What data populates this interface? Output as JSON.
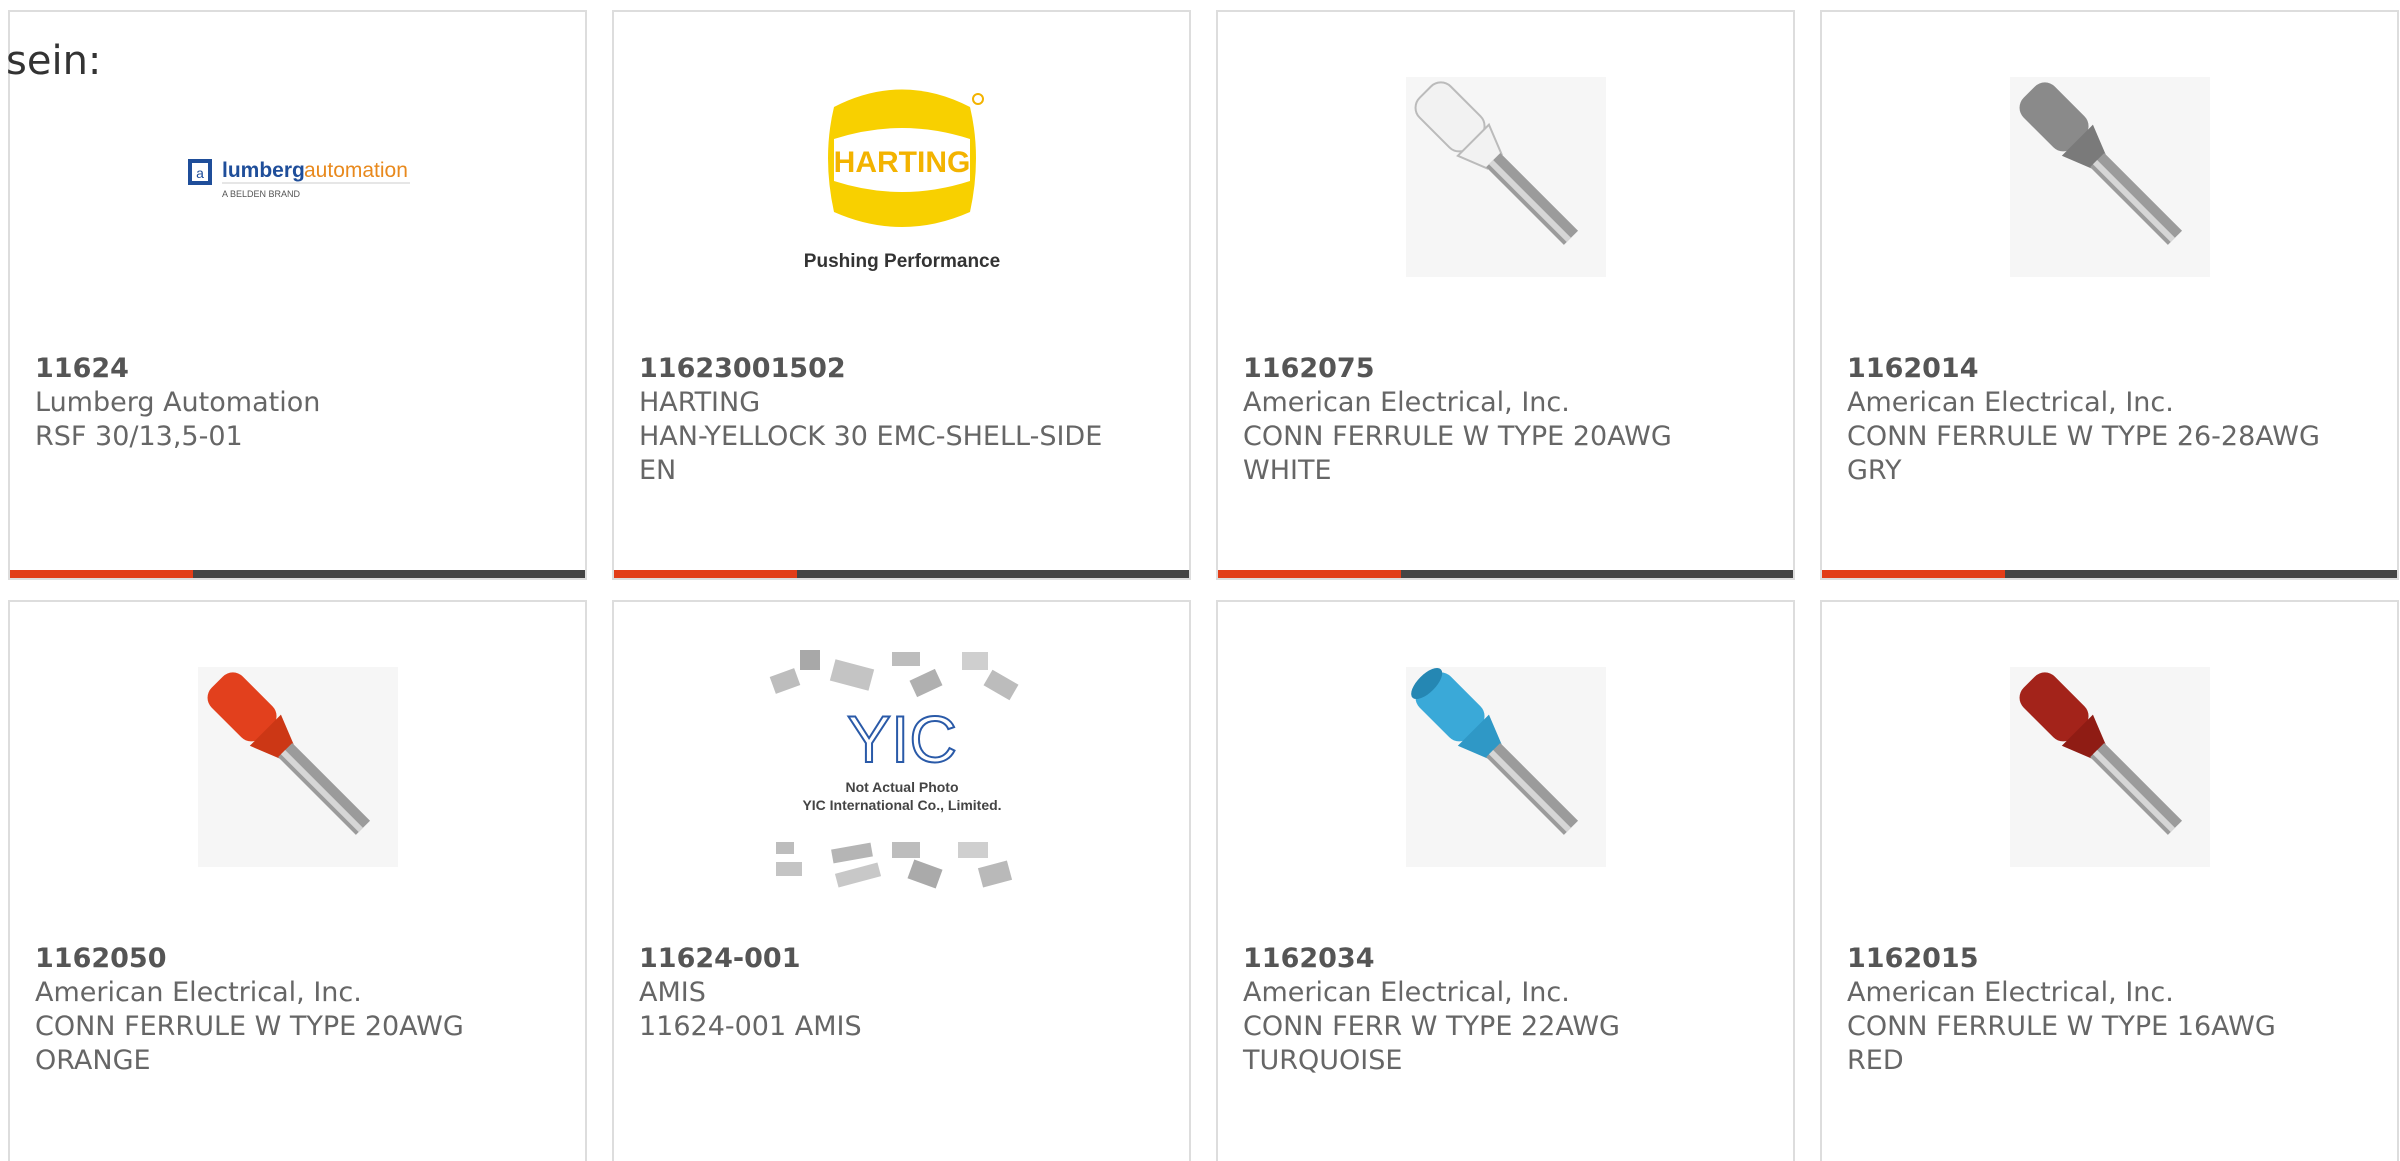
{
  "intro_text": "sein:",
  "colors": {
    "accent": "#e23d18",
    "bar": "#444444",
    "border": "#dddddd",
    "text": "#666666"
  },
  "logos": {
    "lumberg": {
      "brand": "lumberg",
      "brand_accent": "automation",
      "tag": "A BELDEN BRAND"
    },
    "harting": {
      "brand": "HARTING",
      "tagline": "Pushing Performance"
    },
    "yic": {
      "line1": "Not Actual Photo",
      "line2": "YIC International Co., Limited."
    }
  },
  "products": [
    {
      "part": "11624",
      "maker": "Lumberg Automation",
      "desc": "RSF 30/13,5-01",
      "image": "lumberg-logo"
    },
    {
      "part": "11623001502",
      "maker": "HARTING",
      "desc": "HAN-YELLOCK 30 EMC-SHELL-SIDE EN",
      "image": "harting-logo"
    },
    {
      "part": "1162075",
      "maker": "American Electrical, Inc.",
      "desc": "CONN FERRULE W TYPE 20AWG WHITE",
      "image": "ferrule",
      "color": "#f2f2f2"
    },
    {
      "part": "1162014",
      "maker": "American Electrical, Inc.",
      "desc": "CONN FERRULE W TYPE 26-28AWG GRY",
      "image": "ferrule",
      "color": "#8a8a8a"
    },
    {
      "part": "1162050",
      "maker": "American Electrical, Inc.",
      "desc": "CONN FERRULE W TYPE 20AWG ORANGE",
      "image": "ferrule",
      "color": "#e2401d"
    },
    {
      "part": "11624-001",
      "maker": "AMIS",
      "desc": "11624-001 AMIS",
      "image": "yic-placeholder"
    },
    {
      "part": "1162034",
      "maker": "American Electrical, Inc.",
      "desc": "CONN FERR W TYPE 22AWG TURQUOISE",
      "image": "ferrule",
      "color": "#3aa9d8"
    },
    {
      "part": "1162015",
      "maker": "American Electrical, Inc.",
      "desc": "CONN FERRULE W TYPE 16AWG RED",
      "image": "ferrule",
      "color": "#a3231a"
    }
  ]
}
